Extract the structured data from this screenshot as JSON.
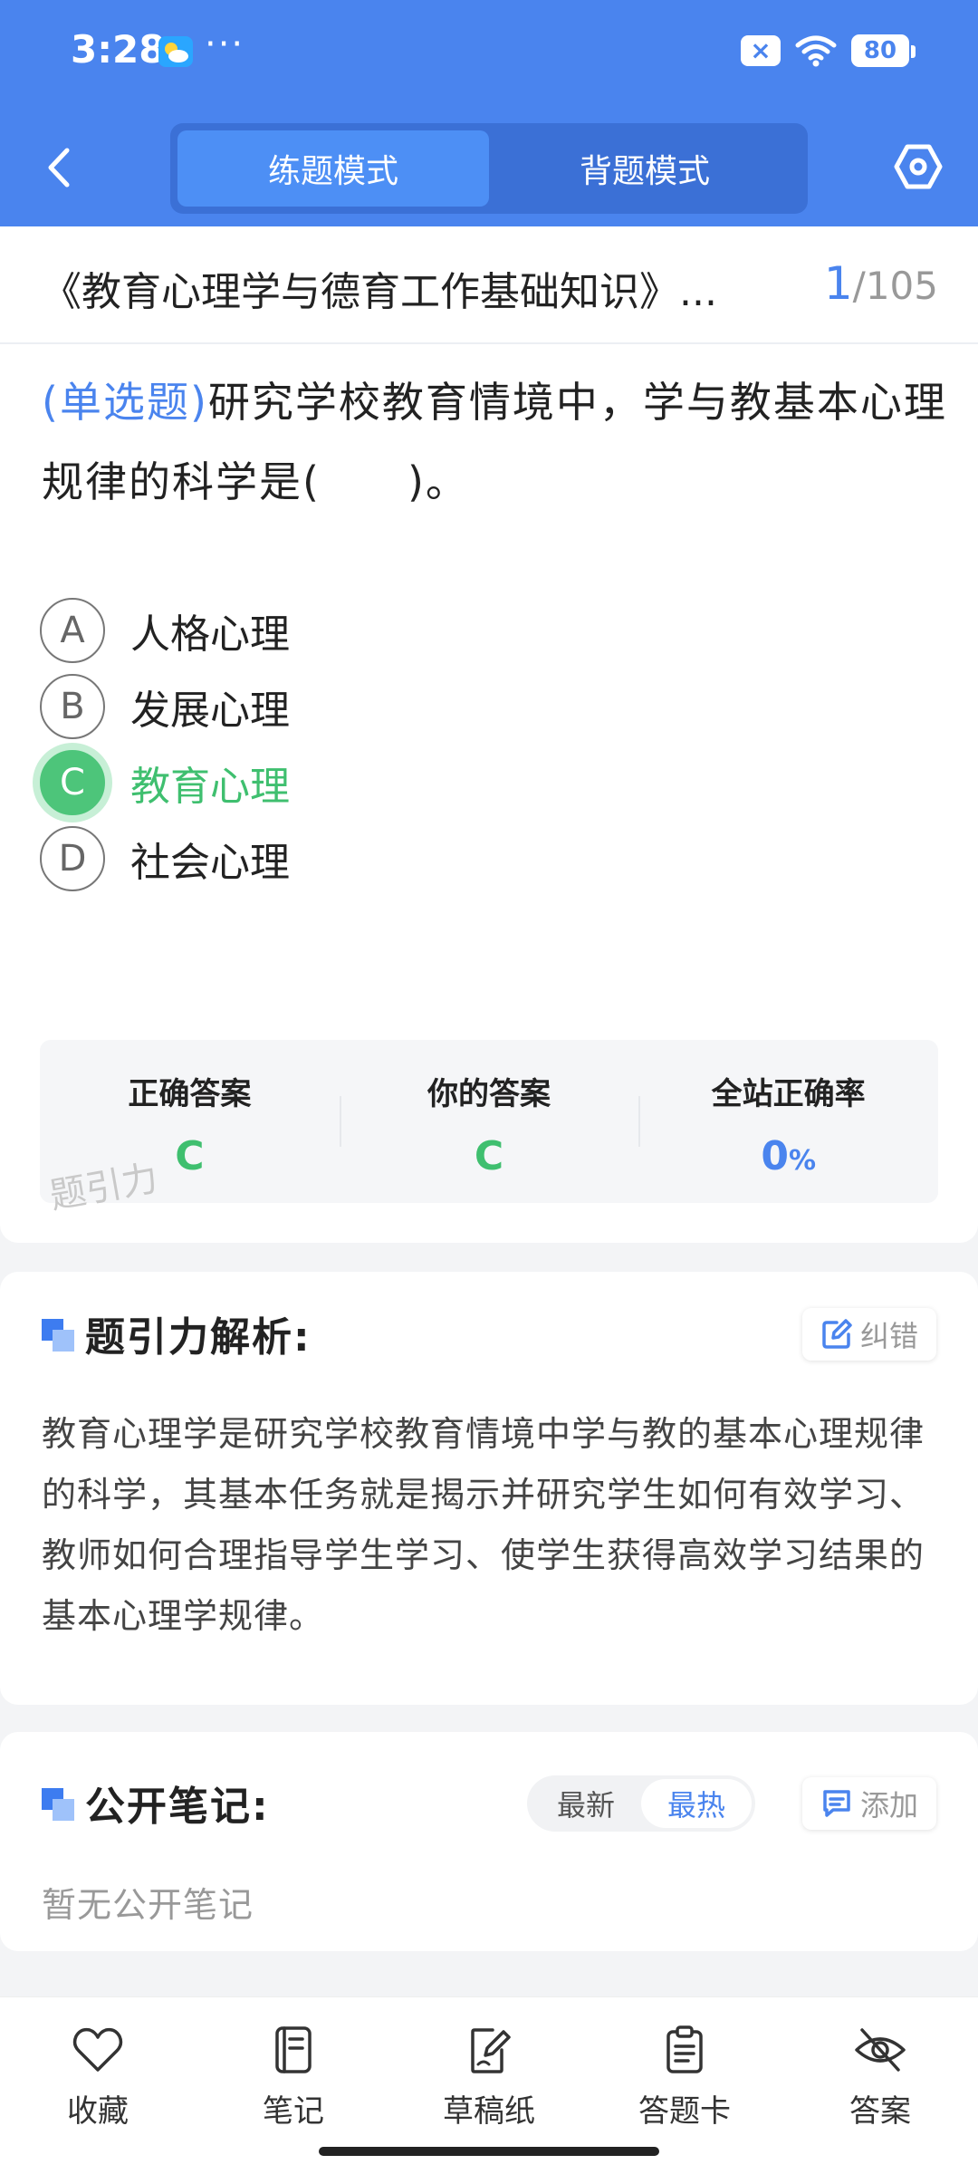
{
  "status": {
    "time": "3:28",
    "dots": "···",
    "x_badge": "×",
    "battery": "80"
  },
  "header": {
    "tabs": [
      {
        "label": "练题模式",
        "active": true
      },
      {
        "label": "背题模式",
        "active": false
      }
    ]
  },
  "title_row": {
    "title": "《教育心理学与德育工作基础知识》...",
    "current": "1",
    "total": "/105"
  },
  "question": {
    "type": "(单选题)",
    "text": "研究学校教育情境中，学与教基本心理规律的科学是(　　)。",
    "options": [
      {
        "letter": "A",
        "text": "人格心理",
        "state": "normal"
      },
      {
        "letter": "B",
        "text": "发展心理",
        "state": "normal"
      },
      {
        "letter": "C",
        "text": "教育心理",
        "state": "correct"
      },
      {
        "letter": "D",
        "text": "社会心理",
        "state": "normal"
      }
    ]
  },
  "answers": {
    "correct_label": "正确答案",
    "correct_value": "C",
    "yours_label": "你的答案",
    "yours_value": "C",
    "rate_label": "全站正确率",
    "rate_value": "0",
    "rate_unit": "%",
    "watermark": "题引力"
  },
  "analysis": {
    "title": "题引力解析:",
    "report_label": "纠错",
    "text": "教育心理学是研究学校教育情境中学与教的基本心理规律的科学，其基本任务就是揭示并研究学生如何有效学习、教师如何合理指导学生学习、使学生获得高效学习结果的基本心理学规律。"
  },
  "notes": {
    "title": "公开笔记:",
    "sort_newest": "最新",
    "sort_hottest": "最热",
    "add_label": "添加",
    "empty": "暂无公开笔记"
  },
  "bottom_bar": [
    {
      "label": "收藏",
      "icon": "heart-icon"
    },
    {
      "label": "笔记",
      "icon": "notebook-icon"
    },
    {
      "label": "草稿纸",
      "icon": "draft-paper-icon"
    },
    {
      "label": "答题卡",
      "icon": "answer-card-icon"
    },
    {
      "label": "答案",
      "icon": "eye-off-icon"
    }
  ],
  "colors": {
    "primary": "#4a84ee",
    "correct": "#4dc57a",
    "accent_light": "#9fc2fa"
  }
}
